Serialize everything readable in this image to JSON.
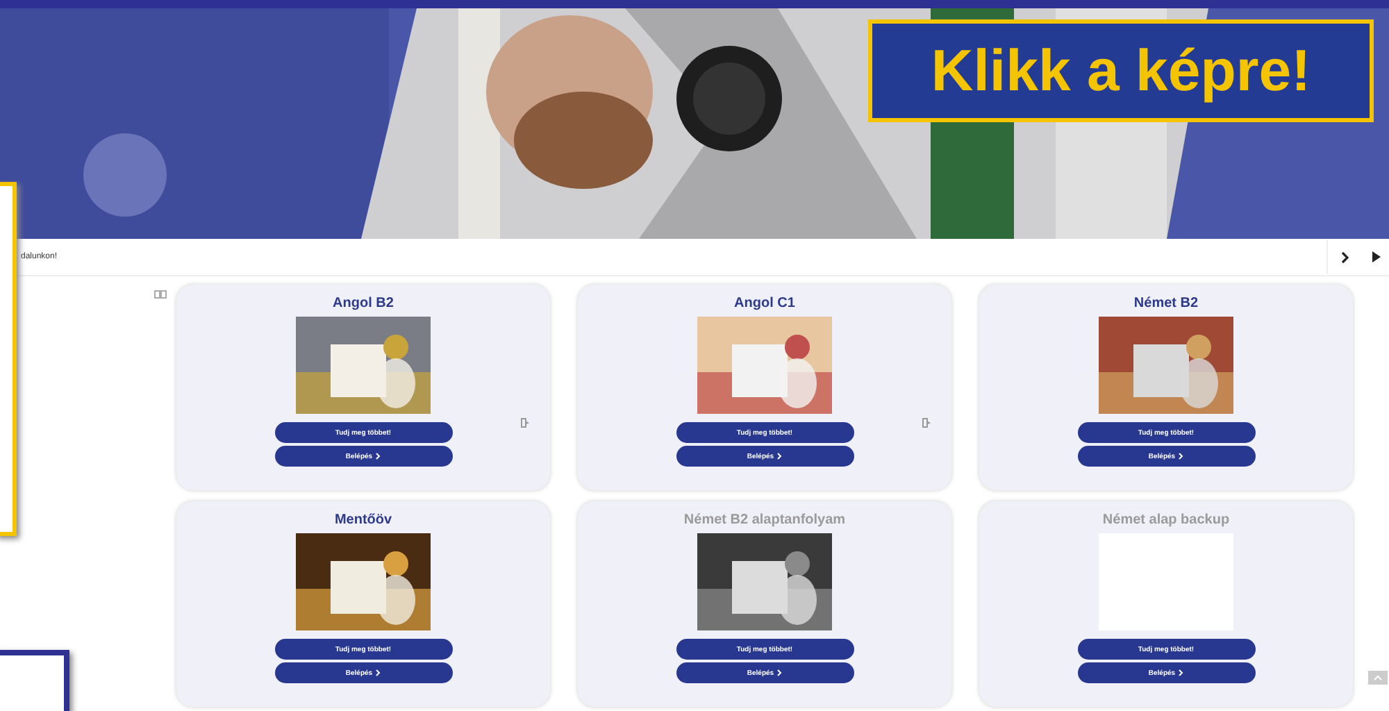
{
  "banner": {
    "callout": "Klikk a képre!"
  },
  "notice": {
    "text": "dalunkon!"
  },
  "cards": [
    {
      "title": "Angol B2",
      "disabled": false,
      "buttons": [
        "Tudj meg többet!",
        "Belépés"
      ],
      "side_icon": true
    },
    {
      "title": "Angol C1",
      "disabled": false,
      "buttons": [
        "Tudj meg többet!",
        "Belépés"
      ],
      "side_icon": true
    },
    {
      "title": "Német B2",
      "disabled": false,
      "buttons": [
        "Tudj meg többet!",
        "Belépés"
      ],
      "side_icon": false
    },
    {
      "title": "Mentőöv",
      "disabled": false,
      "buttons": [
        "Tudj meg többet!",
        "Belépés"
      ],
      "side_icon": false
    },
    {
      "title": "Német B2 alaptanfolyam",
      "disabled": true,
      "buttons": [
        "Tudj meg többet!",
        "Belépés"
      ],
      "side_icon": false
    },
    {
      "title": "Német alap backup",
      "disabled": true,
      "image": {
        "kind": "blank"
      },
      "buttons": [
        "Tudj meg többet!",
        "Belépés"
      ],
      "side_icon": false
    }
  ]
}
